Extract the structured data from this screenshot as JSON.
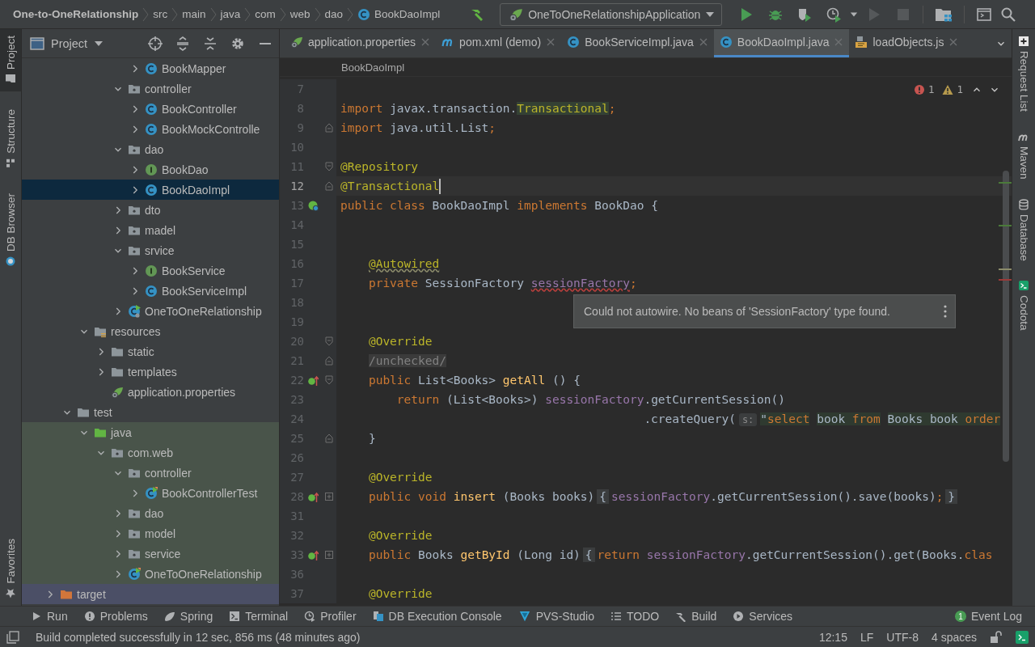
{
  "nav_bar": {
    "breadcrumbs": [
      {
        "label": "One-to-OneRelationship",
        "kind": "project"
      },
      {
        "label": "src",
        "kind": "dir"
      },
      {
        "label": "main",
        "kind": "dir"
      },
      {
        "label": "java",
        "kind": "dir"
      },
      {
        "label": "com",
        "kind": "dir"
      },
      {
        "label": "web",
        "kind": "dir"
      },
      {
        "label": "dao",
        "kind": "dir"
      },
      {
        "label": "BookDaoImpl",
        "kind": "class"
      }
    ],
    "run_config": "OneToOneRelationshipApplication"
  },
  "left_stripe": [
    {
      "label": "Project",
      "kind": "project",
      "selected": true
    },
    {
      "label": "Structure",
      "kind": "structure",
      "selected": false
    },
    {
      "label": "DB Browser",
      "kind": "db",
      "selected": false
    }
  ],
  "left_stripe_bottom": [
    {
      "label": "Favorites",
      "kind": "favorites",
      "selected": false
    }
  ],
  "project_panel": {
    "title": "Project",
    "tree": [
      {
        "children": [
          {
            "children": [
              {
                "children": [
                  {
                    "children": [
                      {
                        "children": [
                          {
                            "label": "BookMapper",
                            "kind": "class",
                            "expanded": false,
                            "selected": false
                          }
                        ]
                      },
                      {
                        "label": "controller",
                        "kind": "package",
                        "expanded": true,
                        "selected": false,
                        "children": [
                          {
                            "label": "BookController",
                            "kind": "class",
                            "expanded": false,
                            "selected": false
                          },
                          {
                            "label": "BookMockControlle",
                            "kind": "class",
                            "expanded": false,
                            "selected": false
                          }
                        ]
                      },
                      {
                        "label": "dao",
                        "kind": "package",
                        "expanded": true,
                        "selected": false,
                        "children": [
                          {
                            "label": "BookDao",
                            "kind": "interface",
                            "expanded": false,
                            "selected": false
                          },
                          {
                            "label": "BookDaoImpl",
                            "kind": "class",
                            "expanded": false,
                            "selected": true
                          }
                        ]
                      },
                      {
                        "label": "dto",
                        "kind": "package",
                        "expanded": false,
                        "selected": false
                      },
                      {
                        "label": "madel",
                        "kind": "package",
                        "expanded": false,
                        "selected": false
                      },
                      {
                        "label": "srvice",
                        "kind": "package",
                        "expanded": true,
                        "selected": false,
                        "children": [
                          {
                            "label": "BookService",
                            "kind": "interface",
                            "expanded": false,
                            "selected": false
                          },
                          {
                            "label": "BookServiceImpl",
                            "kind": "class",
                            "expanded": false,
                            "selected": false
                          }
                        ]
                      },
                      {
                        "label": "OneToOneRelationship",
                        "kind": "spring-class",
                        "expanded": false,
                        "selected": false
                      }
                    ]
                  }
                ]
              },
              {
                "label": "resources",
                "kind": "resources",
                "expanded": true,
                "selected": false,
                "children": [
                  {
                    "label": "static",
                    "kind": "folder",
                    "expanded": false,
                    "selected": false
                  },
                  {
                    "label": "templates",
                    "kind": "folder",
                    "expanded": false,
                    "selected": false
                  },
                  {
                    "label": "application.properties",
                    "kind": "properties",
                    "selected": false
                  }
                ]
              }
            ]
          },
          {
            "label": "test",
            "kind": "folder",
            "expanded": true,
            "selected": false,
            "children": [
              {
                "label": "java",
                "kind": "test-root",
                "expanded": true,
                "selected": false,
                "children": [
                  {
                    "label": "com.web",
                    "kind": "package",
                    "expanded": true,
                    "selected": false,
                    "children": [
                      {
                        "label": "controller",
                        "kind": "package",
                        "expanded": true,
                        "selected": false,
                        "children": [
                          {
                            "label": "BookControllerTest",
                            "kind": "test-class",
                            "expanded": false,
                            "selected": false
                          }
                        ]
                      },
                      {
                        "label": "dao",
                        "kind": "package",
                        "expanded": false,
                        "selected": false
                      },
                      {
                        "label": "model",
                        "kind": "package",
                        "expanded": false,
                        "selected": false
                      },
                      {
                        "label": "service",
                        "kind": "package",
                        "expanded": false,
                        "selected": false
                      },
                      {
                        "label": "OneToOneRelationship",
                        "kind": "test-class",
                        "expanded": false,
                        "selected": false
                      }
                    ]
                  }
                ]
              }
            ]
          }
        ]
      },
      {
        "label": "target",
        "kind": "excluded",
        "expanded": false,
        "selected": false
      }
    ]
  },
  "tabs": [
    {
      "label": "application.properties",
      "kind": "properties",
      "selected": false
    },
    {
      "label": "pom.xml (demo)",
      "kind": "maven",
      "selected": false
    },
    {
      "label": "BookServiceImpl.java",
      "kind": "class",
      "selected": false
    },
    {
      "label": "BookDaoImpl.java",
      "kind": "class",
      "selected": true
    },
    {
      "label": "loadObjects.js",
      "kind": "js",
      "selected": false
    }
  ],
  "breadcrumb": "BookDaoImpl",
  "inspections": {
    "errors": "1",
    "warnings": "1"
  },
  "editor": {
    "lines": [
      {
        "number": "7",
        "current": false
      },
      {
        "number": "8",
        "current": false,
        "tokens": [
          {
            "text": "import",
            "kind": "kw"
          },
          {
            "text": " javax.transaction.",
            "kind": "plain"
          },
          {
            "text": "Transactional",
            "kind": "annref"
          },
          {
            "text": ";",
            "kind": "kw"
          }
        ]
      },
      {
        "number": "9",
        "current": false,
        "fold_marker": {
          "kind": "end"
        },
        "tokens": [
          {
            "text": "import",
            "kind": "kw"
          },
          {
            "text": " java.util.List",
            "kind": "plain"
          },
          {
            "text": ";",
            "kind": "kw"
          }
        ]
      },
      {
        "number": "10",
        "current": false
      },
      {
        "number": "11",
        "current": false,
        "fold_marker": {
          "kind": "start"
        },
        "tokens": [
          {
            "text": "@Repository",
            "kind": "ann"
          }
        ]
      },
      {
        "number": "12",
        "current": true,
        "fold_marker": {
          "kind": "end"
        },
        "tokens": [
          {
            "text": "@Transactional",
            "kind": "ann"
          }
        ]
      },
      {
        "number": "13",
        "current": false,
        "gutter_icon": {
          "kind": "bean"
        },
        "tokens": [
          {
            "text": "public class",
            "kind": "kw"
          },
          {
            "text": " BookDaoImpl ",
            "kind": "plain"
          },
          {
            "text": "implements",
            "kind": "kw"
          },
          {
            "text": " BookDao {",
            "kind": "plain"
          }
        ]
      },
      {
        "number": "14",
        "current": false
      },
      {
        "number": "15",
        "current": false
      },
      {
        "number": "16",
        "current": false,
        "tokens": [
          {
            "text": "    @Autowired",
            "kind": "ann-warn"
          }
        ]
      },
      {
        "number": "17",
        "current": false,
        "tokens": [
          {
            "text": "    private",
            "kind": "kw"
          },
          {
            "text": " SessionFactory ",
            "kind": "plain"
          },
          {
            "text": "sessionFactory",
            "kind": "field-err"
          },
          {
            "text": ";",
            "kind": "kw"
          }
        ]
      },
      {
        "number": "18",
        "current": false
      },
      {
        "number": "19",
        "current": false
      },
      {
        "number": "20",
        "current": false,
        "fold_marker": {
          "kind": "start"
        },
        "tokens": [
          {
            "text": "    @Override",
            "kind": "ann"
          }
        ]
      },
      {
        "number": "21",
        "current": false,
        "fold_marker": {
          "kind": "end"
        },
        "tokens": [
          {
            "text": "    /unchecked/",
            "kind": "muted"
          }
        ]
      },
      {
        "number": "22",
        "current": false,
        "gutter_icon": {
          "kind": "override"
        },
        "fold_marker": {
          "kind": "start"
        },
        "tokens": [
          {
            "text": "    public",
            "kind": "kw"
          },
          {
            "text": " List<Books> ",
            "kind": "plain"
          },
          {
            "text": "getAll",
            "kind": "method"
          },
          {
            "text": " () {",
            "kind": "plain"
          }
        ]
      },
      {
        "number": "23",
        "current": false,
        "tokens": [
          {
            "text": "        return",
            "kind": "kw"
          },
          {
            "text": " (List<Books>) ",
            "kind": "plain"
          },
          {
            "text": "sessionFactory",
            "kind": "field"
          },
          {
            "text": ".getCurrentSession()",
            "kind": "plain"
          }
        ]
      },
      {
        "number": "24",
        "current": false,
        "tokens": [
          {
            "text": "                                           .createQuery(",
            "kind": "plain"
          },
          {
            "text": "s:",
            "kind": "hint"
          },
          {
            "text": "\"",
            "kind": "sql"
          },
          {
            "text": "select",
            "kind": "sql-kw"
          },
          {
            "text": " book ",
            "kind": "sql"
          },
          {
            "text": "from",
            "kind": "sql-kw"
          },
          {
            "text": " Books book ",
            "kind": "sql"
          },
          {
            "text": "order",
            "kind": "sql-kw"
          }
        ]
      },
      {
        "number": "25",
        "current": false,
        "fold_marker": {
          "kind": "end"
        },
        "tokens": [
          {
            "text": "    }",
            "kind": "plain"
          }
        ]
      },
      {
        "number": "26",
        "current": false
      },
      {
        "number": "27",
        "current": false,
        "tokens": [
          {
            "text": "    @Override",
            "kind": "ann"
          }
        ]
      },
      {
        "number": "28",
        "current": false,
        "gutter_icon": {
          "kind": "override"
        },
        "fold_marker": {
          "kind": "collapsed"
        },
        "tokens": [
          {
            "text": "    public void",
            "kind": "kw"
          },
          {
            "text": " insert",
            "kind": "method"
          },
          {
            "text": " (Books books)",
            "kind": "plain"
          },
          {
            "text": "{",
            "kind": "fold"
          },
          {
            "text": "sessionFactory",
            "kind": "field"
          },
          {
            "text": ".getCurrentSession().save(books)",
            "kind": "plain"
          },
          {
            "text": ";",
            "kind": "kw"
          },
          {
            "text": "}",
            "kind": "fold"
          }
        ]
      },
      {
        "number": "31",
        "current": false
      },
      {
        "number": "32",
        "current": false,
        "tokens": [
          {
            "text": "    @Override",
            "kind": "ann"
          }
        ]
      },
      {
        "number": "33",
        "current": false,
        "gutter_icon": {
          "kind": "override"
        },
        "fold_marker": {
          "kind": "collapsed"
        },
        "tokens": [
          {
            "text": "    public",
            "kind": "kw"
          },
          {
            "text": " Books ",
            "kind": "plain"
          },
          {
            "text": "getById",
            "kind": "method"
          },
          {
            "text": " (Long id)",
            "kind": "plain"
          },
          {
            "text": "{",
            "kind": "fold"
          },
          {
            "text": "return",
            "kind": "kw"
          },
          {
            "text": " sessionFactory",
            "kind": "field"
          },
          {
            "text": ".getCurrentSession().get(Books.",
            "kind": "plain"
          },
          {
            "text": "clas",
            "kind": "kw"
          }
        ]
      },
      {
        "number": "36",
        "current": false
      },
      {
        "number": "37",
        "current": false,
        "tokens": [
          {
            "text": "    @Override",
            "kind": "ann"
          }
        ]
      }
    ]
  },
  "tooltip": {
    "text": "Could not autowire. No beans of 'SessionFactory' type found."
  },
  "right_stripe": [
    {
      "label": "Request List",
      "kind": "request"
    },
    {
      "label": "Maven",
      "kind": "maven"
    },
    {
      "label": "Database",
      "kind": "database"
    },
    {
      "label": "Codota",
      "kind": "codota"
    }
  ],
  "tool_windows": [
    {
      "label": "Run",
      "kind": "run"
    },
    {
      "label": "Problems",
      "kind": "problems"
    },
    {
      "label": "Spring",
      "kind": "spring"
    },
    {
      "label": "Terminal",
      "kind": "terminal"
    },
    {
      "label": "Profiler",
      "kind": "profiler"
    },
    {
      "label": "DB Execution Console",
      "kind": "db"
    },
    {
      "label": "PVS-Studio",
      "kind": "pvs"
    },
    {
      "label": "TODO",
      "kind": "todo"
    },
    {
      "label": "Build",
      "kind": "build"
    },
    {
      "label": "Services",
      "kind": "services"
    },
    {
      "label": "Event Log",
      "kind": "event-log",
      "badge": "1"
    }
  ],
  "status_bar": {
    "message": "Build completed successfully in 12 sec, 856 ms (48 minutes ago)",
    "items": [
      "12:15",
      "LF",
      "UTF-8",
      "4 spaces"
    ]
  }
}
